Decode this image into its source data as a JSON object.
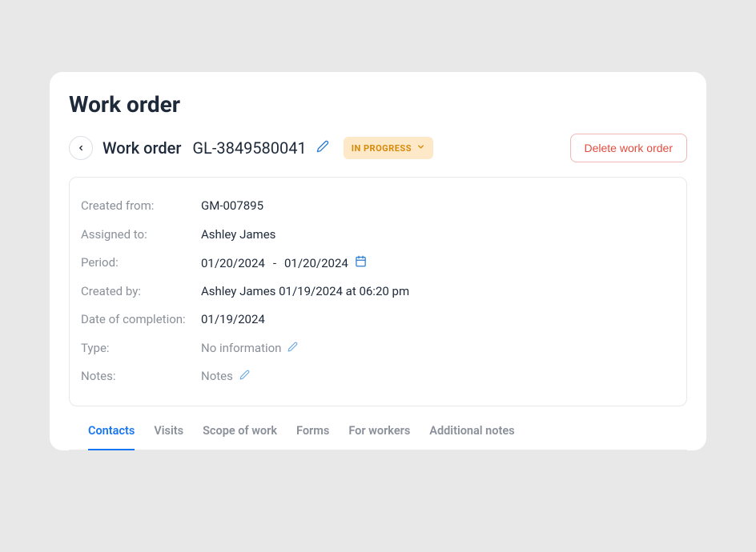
{
  "page_title": "Work order",
  "header": {
    "label": "Work order",
    "number": "GL-3849580041",
    "status": "IN PROGRESS",
    "delete_label": "Delete work order"
  },
  "details": {
    "created_from": {
      "label": "Created from:",
      "value": "GM-007895"
    },
    "assigned_to": {
      "label": "Assigned to:",
      "value": "Ashley James"
    },
    "period": {
      "label": "Period:",
      "start": "01/20/2024",
      "sep": "-",
      "end": "01/20/2024"
    },
    "created_by": {
      "label": "Created by:",
      "value": "Ashley James 01/19/2024 at 06:20 pm"
    },
    "date_of_completion": {
      "label": "Date of completion:",
      "value": "01/19/2024"
    },
    "type": {
      "label": "Type:",
      "value": "No information"
    },
    "notes": {
      "label": "Notes:",
      "value": "Notes"
    }
  },
  "tabs": [
    {
      "label": "Contacts",
      "active": true
    },
    {
      "label": "Visits",
      "active": false
    },
    {
      "label": "Scope of work",
      "active": false
    },
    {
      "label": "Forms",
      "active": false
    },
    {
      "label": "For workers",
      "active": false
    },
    {
      "label": "Additional notes",
      "active": false
    }
  ]
}
